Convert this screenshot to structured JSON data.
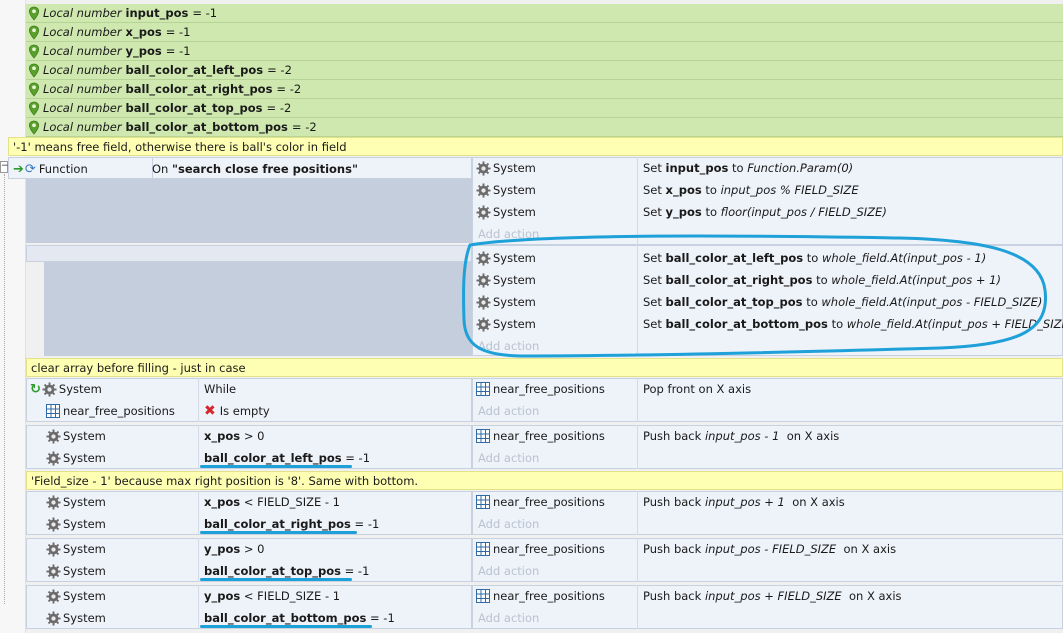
{
  "local_vars": [
    {
      "label": "Local number",
      "name": "input_pos",
      "value": "= -1"
    },
    {
      "label": "Local number",
      "name": "x_pos",
      "value": "= -1"
    },
    {
      "label": "Local number",
      "name": "y_pos",
      "value": "= -1"
    },
    {
      "label": "Local number",
      "name": "ball_color_at_left_pos",
      "value": "= -2"
    },
    {
      "label": "Local number",
      "name": "ball_color_at_right_pos",
      "value": "= -2"
    },
    {
      "label": "Local number",
      "name": "ball_color_at_top_pos",
      "value": "= -2"
    },
    {
      "label": "Local number",
      "name": "ball_color_at_bottom_pos",
      "value": "= -2"
    }
  ],
  "comments": {
    "free_field": "'-1' means free field, otherwise there is ball's color in field",
    "clear_array": "clear array before filling - just in case",
    "field_size": "'Field_size - 1' because max right position is '8'. Same with bottom."
  },
  "function_event": {
    "type_label": "Function",
    "on_prefix": "On",
    "name": "\"search close free positions\""
  },
  "system": "System",
  "add_action": "Add action",
  "near_free_positions": "near_free_positions",
  "block1": [
    {
      "set": "Set",
      "var": "input_pos",
      "to": "to",
      "expr": "Function.Param(0)"
    },
    {
      "set": "Set",
      "var": "x_pos",
      "to": "to",
      "expr": "input_pos % FIELD_SIZE"
    },
    {
      "set": "Set",
      "var": "y_pos",
      "to": "to",
      "expr": "floor(input_pos / FIELD_SIZE)"
    }
  ],
  "block2": [
    {
      "set": "Set",
      "var": "ball_color_at_left_pos",
      "to": "to",
      "expr": "whole_field.At(input_pos - 1)"
    },
    {
      "set": "Set",
      "var": "ball_color_at_right_pos",
      "to": "to",
      "expr": "whole_field.At(input_pos + 1)"
    },
    {
      "set": "Set",
      "var": "ball_color_at_top_pos",
      "to": "to",
      "expr": "whole_field.At(input_pos - FIELD_SIZE)"
    },
    {
      "set": "Set",
      "var": "ball_color_at_bottom_pos",
      "to": "to",
      "expr": "whole_field.At(input_pos + FIELD_SIZE)"
    }
  ],
  "while_block": {
    "while": "While",
    "is_empty": "Is empty",
    "action": "Pop front on X axis"
  },
  "push_blocks": [
    {
      "cond1_var": "x_pos",
      "cond1_rest": "> 0",
      "cond2_var": "ball_color_at_left_pos",
      "cond2_rest": "= -1",
      "act_pre": "Push back",
      "act_expr": "input_pos - 1",
      "act_post": "on X axis"
    },
    {
      "cond1_var": "x_pos",
      "cond1_rest": "< FIELD_SIZE - 1",
      "cond2_var": "ball_color_at_right_pos",
      "cond2_rest": "= -1",
      "act_pre": "Push back",
      "act_expr": "input_pos + 1",
      "act_post": "on X axis"
    },
    {
      "cond1_var": "y_pos",
      "cond1_rest": "> 0",
      "cond2_var": "ball_color_at_top_pos",
      "cond2_rest": "= -1",
      "act_pre": "Push back",
      "act_expr": "input_pos - FIELD_SIZE",
      "act_post": "on X axis"
    },
    {
      "cond1_var": "y_pos",
      "cond1_rest": "< FIELD_SIZE - 1",
      "cond2_var": "ball_color_at_bottom_pos",
      "cond2_rest": "= -1",
      "act_pre": "Push back",
      "act_expr": "input_pos + FIELD_SIZE",
      "act_post": "on X axis"
    }
  ],
  "colors": {
    "local_var_bg": "#cfe8b0",
    "comment_bg": "#ffffb4",
    "event_bg": "#eef2f9",
    "subevent_block": "#c4cedd",
    "annotation": "#1ea0d8"
  }
}
